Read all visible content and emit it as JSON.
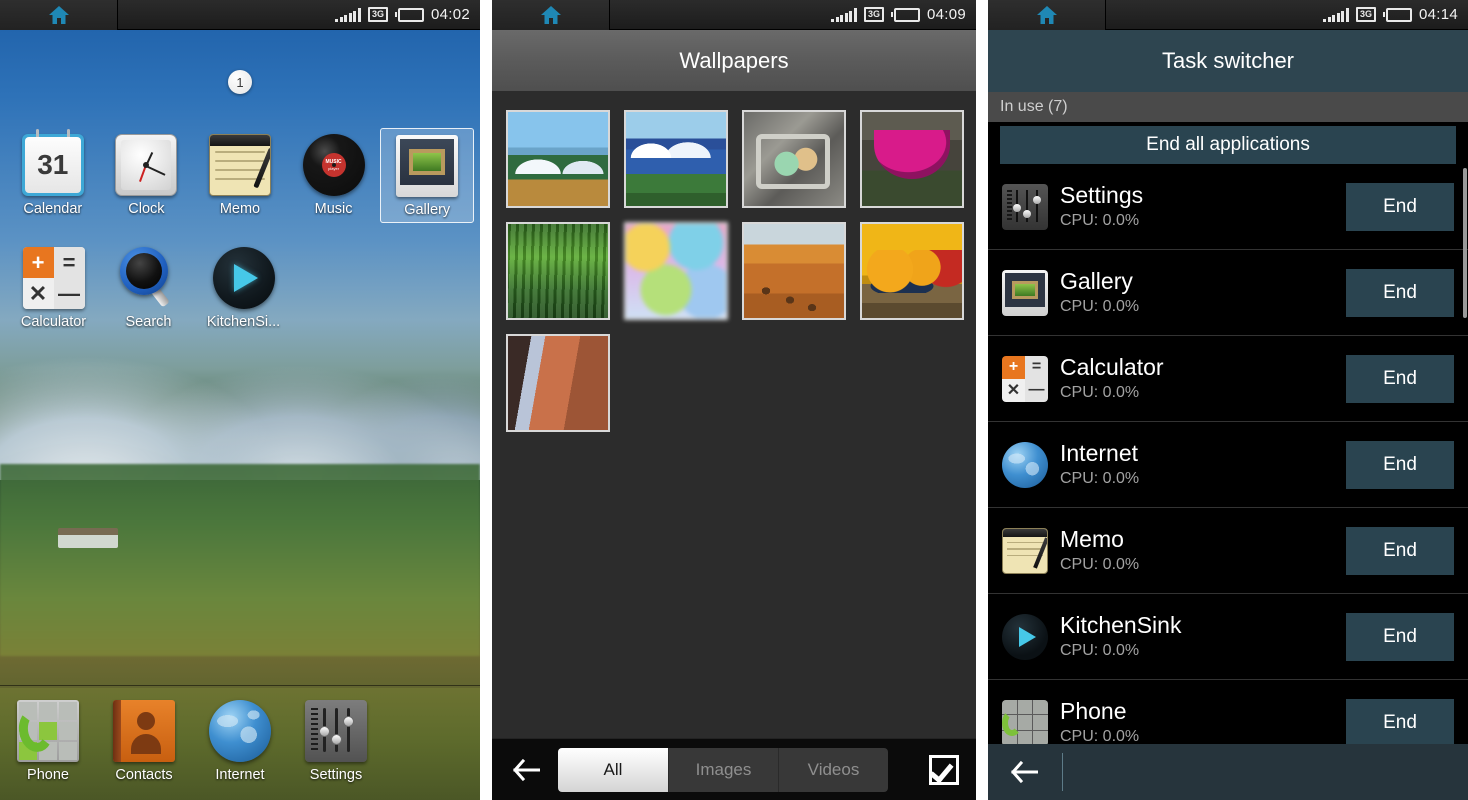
{
  "panels": {
    "home": {
      "statusbar": {
        "home_icon": "home-icon",
        "signal_icon": "signal-bars-icon",
        "network": "3G",
        "battery_icon": "battery-icon",
        "time": "04:02"
      },
      "page_indicator": "1",
      "apps": [
        {
          "label": "Calendar",
          "icon": "calendar-icon",
          "day": "31"
        },
        {
          "label": "Clock",
          "icon": "clock-icon"
        },
        {
          "label": "Memo",
          "icon": "memo-icon"
        },
        {
          "label": "Music",
          "icon": "music-icon",
          "disc_label": "MUSIC",
          "disc_sub": "player"
        },
        {
          "label": "Gallery",
          "icon": "gallery-icon",
          "selected": true
        },
        {
          "label": "Calculator",
          "icon": "calculator-icon"
        },
        {
          "label": "Search",
          "icon": "search-icon"
        },
        {
          "label": "KitchenSi...",
          "icon": "kitchensink-icon"
        }
      ],
      "dock": [
        {
          "label": "Phone",
          "icon": "phone-icon"
        },
        {
          "label": "Contacts",
          "icon": "contacts-icon"
        },
        {
          "label": "Internet",
          "icon": "internet-globe-icon"
        },
        {
          "label": "Settings",
          "icon": "settings-sliders-icon"
        }
      ]
    },
    "wallpapers": {
      "statusbar": {
        "home_icon": "home-icon",
        "network": "3G",
        "time": "04:09"
      },
      "title": "Wallpapers",
      "thumbnails": [
        {
          "name": "mountain-lake-thumbnail"
        },
        {
          "name": "snowy-mountains-thumbnail"
        },
        {
          "name": "bicycle-basket-thumbnail"
        },
        {
          "name": "pink-flower-bowl-thumbnail"
        },
        {
          "name": "green-bamboo-thumbnail"
        },
        {
          "name": "pastel-blur-thumbnail"
        },
        {
          "name": "desert-camels-thumbnail"
        },
        {
          "name": "fruit-bowl-thumbnail"
        },
        {
          "name": "canyon-thumbnail"
        }
      ],
      "toolbar": {
        "back_icon": "back-arrow-icon",
        "tabs": [
          {
            "label": "All",
            "active": true
          },
          {
            "label": "Images",
            "active": false
          },
          {
            "label": "Videos",
            "active": false
          }
        ],
        "select_icon": "checkbox-checked-icon"
      }
    },
    "taskswitcher": {
      "statusbar": {
        "home_icon": "home-icon",
        "network": "3G",
        "time": "04:14"
      },
      "title": "Task switcher",
      "in_use": "In use (7)",
      "end_all_label": "End all applications",
      "cpu_prefix": "CPU: ",
      "tasks": [
        {
          "name": "Settings",
          "cpu": "CPU: 0.0%",
          "icon": "settings-sliders-icon",
          "end_label": "End"
        },
        {
          "name": "Gallery",
          "cpu": "CPU: 0.0%",
          "icon": "gallery-icon",
          "end_label": "End"
        },
        {
          "name": "Calculator",
          "cpu": "CPU: 0.0%",
          "icon": "calculator-icon",
          "end_label": "End"
        },
        {
          "name": "Internet",
          "cpu": "CPU: 0.0%",
          "icon": "internet-globe-icon",
          "end_label": "End"
        },
        {
          "name": "Memo",
          "cpu": "CPU: 0.0%",
          "icon": "memo-icon",
          "end_label": "End"
        },
        {
          "name": "KitchenSink",
          "cpu": "CPU: 0.0%",
          "icon": "kitchensink-icon",
          "end_label": "End"
        },
        {
          "name": "Phone",
          "cpu": "CPU: 0.0%",
          "icon": "phone-icon",
          "end_label": "End"
        }
      ],
      "bottom": {
        "back_icon": "back-arrow-icon"
      }
    }
  },
  "colors": {
    "accent_blue": "#2e4550",
    "button_blue": "#2a4450",
    "status_bg": "#232323",
    "home_icon": "#1f88b5",
    "wall_bg": "#2c2c2c",
    "title_gray": "#5b5b5b"
  }
}
